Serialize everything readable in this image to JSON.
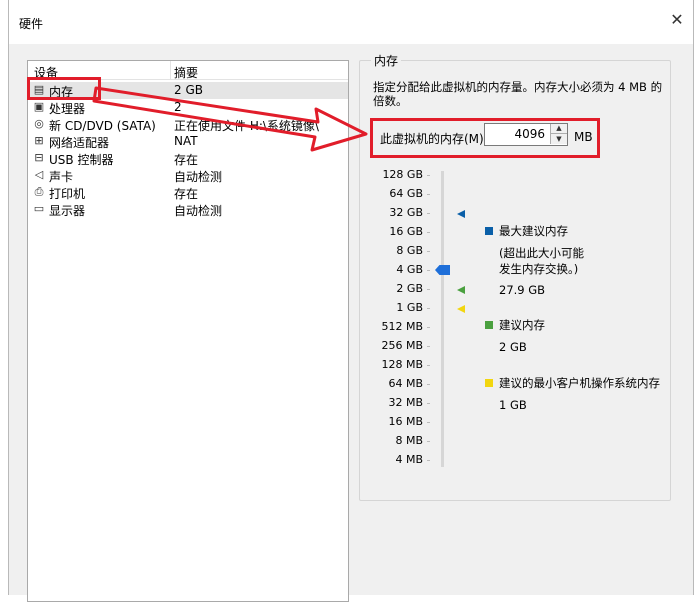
{
  "window": {
    "title": "硬件"
  },
  "device_list": {
    "columns": [
      "设备",
      "摘要"
    ],
    "rows": [
      {
        "icon": "memory-icon",
        "name": "内存",
        "summary": "2 GB",
        "selected": true
      },
      {
        "icon": "processor-icon",
        "name": "处理器",
        "summary": "2"
      },
      {
        "icon": "cd-dvd-icon",
        "name": "新 CD/DVD (SATA)",
        "summary": "正在使用文件 H:\\系统镜像\\"
      },
      {
        "icon": "network-adapter-icon",
        "name": "网络适配器",
        "summary": "NAT"
      },
      {
        "icon": "usb-icon",
        "name": "USB 控制器",
        "summary": "存在"
      },
      {
        "icon": "sound-card-icon",
        "name": "声卡",
        "summary": "自动检测"
      },
      {
        "icon": "printer-icon",
        "name": "打印机",
        "summary": "存在"
      },
      {
        "icon": "display-icon",
        "name": "显示器",
        "summary": "自动检测"
      }
    ]
  },
  "memory": {
    "group_title": "内存",
    "description": "指定分配给此虚拟机的内存量。内存大小必须为 4 MB 的倍数。",
    "field_label": "此虚拟机的内存(M):",
    "value": "4096",
    "unit": "MB",
    "slider_level": "4 GB",
    "scale": [
      "128 GB",
      "64 GB",
      "32 GB",
      "16 GB",
      "8 GB",
      "4 GB",
      "2 GB",
      "1 GB",
      "512 MB",
      "256 MB",
      "128 MB",
      "64 MB",
      "32 MB",
      "16 MB",
      "8 MB",
      "4 MB"
    ],
    "legend": {
      "max_recommended": {
        "label": "最大建议内存",
        "note_line1": "(超出此大小可能",
        "note_line2": "发生内存交换。)",
        "value": "27.9 GB",
        "color": "#0a5fa8"
      },
      "recommended": {
        "label": "建议内存",
        "value": "2 GB",
        "color": "#4aa03f"
      },
      "min_recommended": {
        "label": "建议的最小客户机操作系统内存",
        "value": "1 GB",
        "color": "#f2d60f"
      }
    }
  },
  "annotation_color": "#e11d2a"
}
